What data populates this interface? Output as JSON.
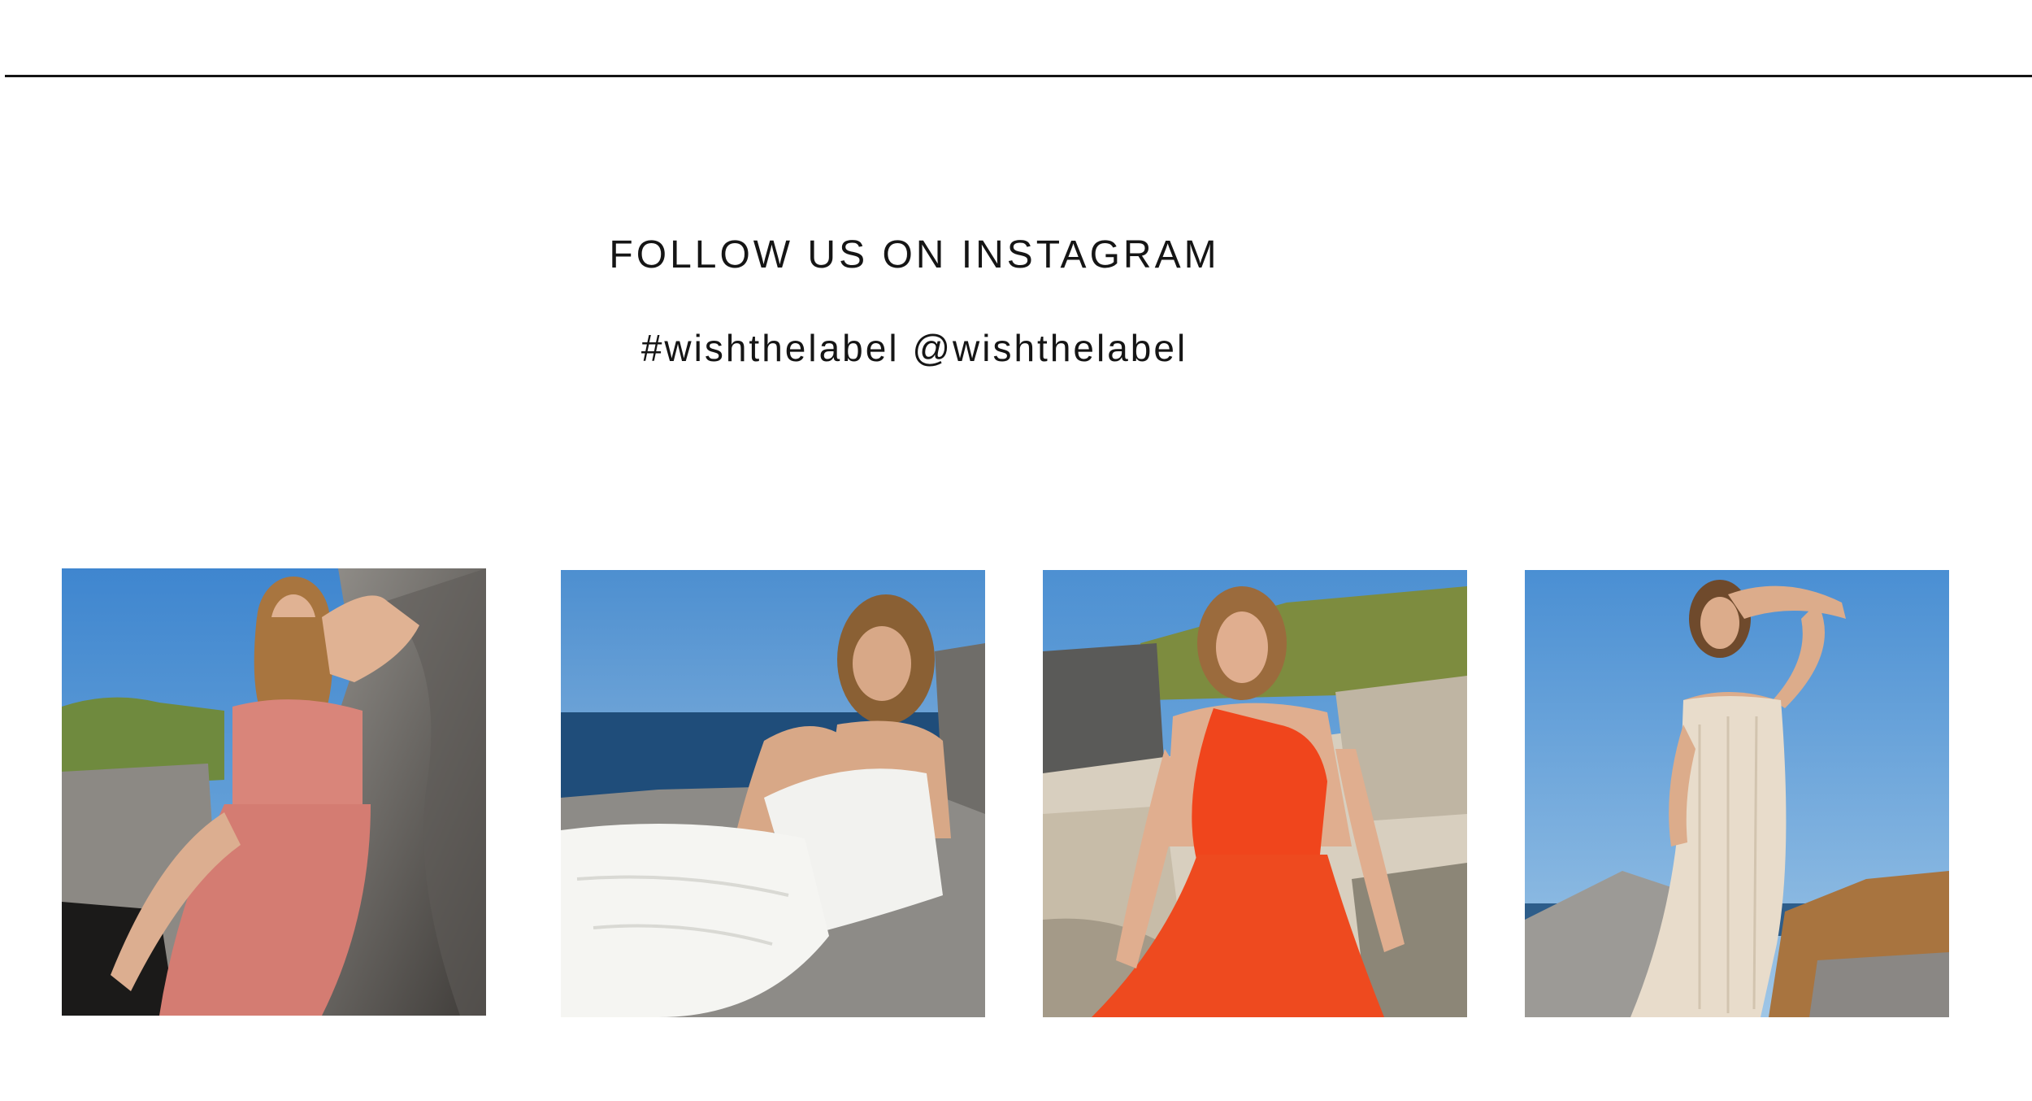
{
  "section": {
    "title": "FOLLOW US ON INSTAGRAM",
    "handles": "#wishthelabel @wishthelabel"
  },
  "feed": {
    "posts": [
      {
        "name": "instagram-post-1",
        "icon": "photo-model-floral-dress"
      },
      {
        "name": "instagram-post-2",
        "icon": "photo-model-white-dress"
      },
      {
        "name": "instagram-post-3",
        "icon": "photo-model-red-dress"
      },
      {
        "name": "instagram-post-4",
        "icon": "photo-model-cream-dress"
      }
    ]
  },
  "colors": {
    "text": "#151515",
    "rule": "#141414",
    "sky": "#4d8fd0",
    "rock": "#8f8b86",
    "floral_dress": "#d9857a",
    "white_dress": "#f2f2ef",
    "red_dress": "#f0451c",
    "cream_dress": "#e8dccb"
  }
}
